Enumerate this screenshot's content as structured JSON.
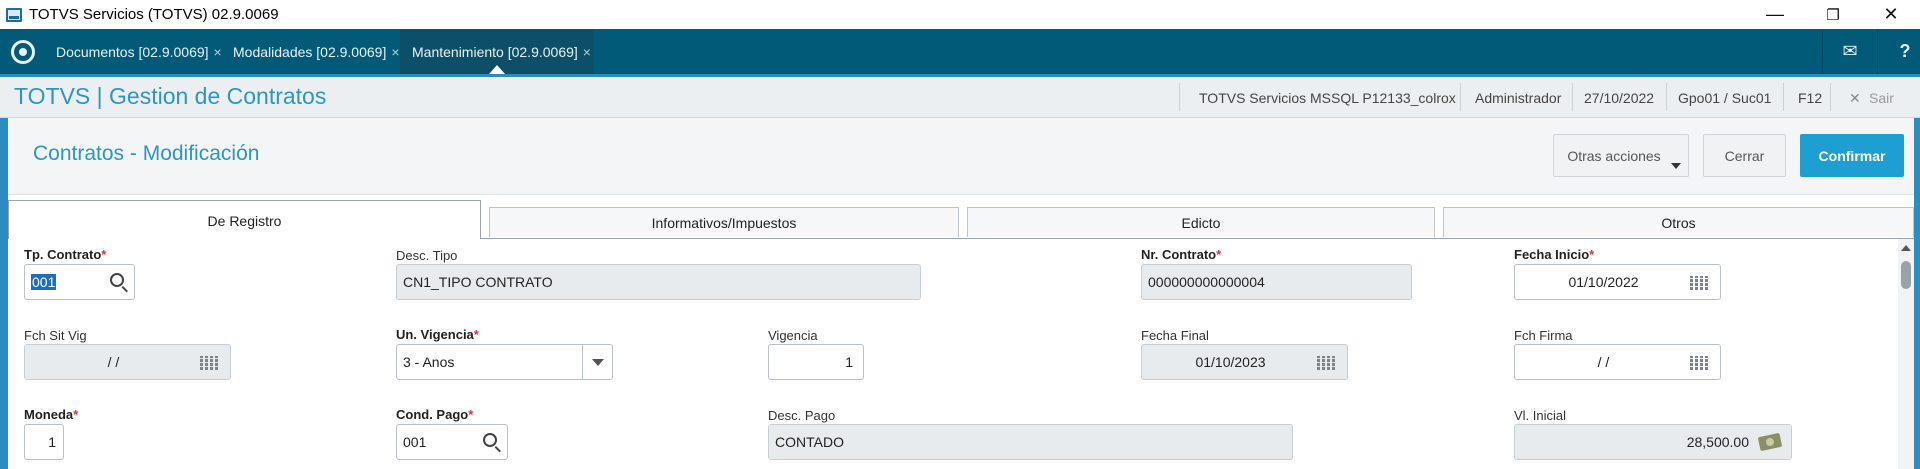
{
  "window": {
    "title": "TOTVS Servicios (TOTVS) 02.9.0069",
    "minimize": "—",
    "restore": "❐",
    "close": "✕"
  },
  "tabs": [
    {
      "label": "Documentos [02.9.0069]",
      "close": "×"
    },
    {
      "label": "Modalidades [02.9.0069]",
      "close": "×"
    },
    {
      "label": "Mantenimiento [02.9.0069]",
      "close": "×",
      "active": true
    }
  ],
  "tabbar_icons": {
    "mail": "✉",
    "help": "?"
  },
  "header": {
    "app_title": "TOTVS | Gestion de Contratos",
    "environment": "TOTVS Servicios MSSQL P12133_colrox",
    "user": "Administrador",
    "date": "27/10/2022",
    "branch": "Gpo01 / Suc01",
    "shortcut": "F12",
    "exit_icon": "✕",
    "exit_label": "Sair"
  },
  "page": {
    "title": "Contratos - Modificación",
    "other_actions_label": "Otras acciones",
    "close_label": "Cerrar",
    "confirm_label": "Confirmar"
  },
  "folders": [
    {
      "label": "De Registro",
      "active": true
    },
    {
      "label": "Informativos/Impuestos"
    },
    {
      "label": "Edicto"
    },
    {
      "label": "Otros"
    }
  ],
  "form": {
    "tp_contrato": {
      "label": "Tp. Contrato",
      "value": "001"
    },
    "desc_tipo": {
      "label": "Desc. Tipo",
      "value": "CN1_TIPO CONTRATO"
    },
    "nr_contrato": {
      "label": "Nr. Contrato",
      "value": "000000000000004"
    },
    "fecha_inicio": {
      "label": "Fecha Inicio",
      "value": "01/10/2022"
    },
    "fch_sit_vig": {
      "label": "Fch Sit Vig",
      "value": "/  /"
    },
    "un_vigencia": {
      "label": "Un. Vigencia",
      "value": "3 - Anos"
    },
    "vigencia": {
      "label": "Vigencia",
      "value": "1"
    },
    "fecha_final": {
      "label": "Fecha Final",
      "value": "01/10/2023"
    },
    "fch_firma": {
      "label": "Fch Firma",
      "value": "/  /"
    },
    "moneda": {
      "label": "Moneda",
      "value": "1"
    },
    "cond_pago": {
      "label": "Cond. Pago",
      "value": "001"
    },
    "desc_pago": {
      "label": "Desc. Pago",
      "value": "CONTADO"
    },
    "vl_inicial": {
      "label": "Vl. Inicial",
      "value": "28,500.00"
    },
    "required_mark": "*"
  },
  "colors": {
    "tabbar": "#005a78",
    "accent": "#2a97c4",
    "primary_button": "#1e9fd1",
    "required": "#e03030"
  }
}
